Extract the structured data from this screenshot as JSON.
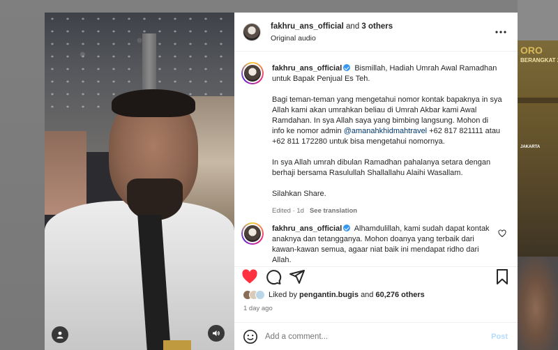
{
  "header": {
    "username": "fakhru_ans_official",
    "and_text": "and",
    "others_text": "3 others",
    "audio": "Original audio"
  },
  "caption": {
    "username": "fakhru_ans_official",
    "line1": "Bismillah, Hadiah Umrah Awal Ramadhan untuk Bapak Penjual Es Teh.",
    "para2_a": "Bagi teman-teman yang mengetahui nomor kontak bapaknya in sya Allah kami akan umrahkan beliau di Umrah Akbar kami Awal Ramdahan. In sya Allah saya yang bimbing langsung. Mohon di info ke nomor admin",
    "mention": "@amanahkhidmahtravel",
    "para2_b": "+62 817 821111 atau +62 811 172280 untuk bisa mengetahui nomornya.",
    "para3": "In sya Allah umrah dibulan Ramadhan pahalanya setara dengan berhaji bersama Rasulullah Shallallahu Alaihi Wasallam.",
    "para4": "Silahkan Share.",
    "edited": "Edited · 1d",
    "see_translation": "See translation"
  },
  "reply": {
    "username": "fakhru_ans_official",
    "text": "Alhamdulillah, kami sudah dapat kontak anaknya dan tetangganya. Mohon doanya yang terbaik dari kawan-kawan semua, agaar niat baik ini mendapat ridho dari Allah."
  },
  "likes": {
    "prefix": "Liked by",
    "user": "pengantin.bugis",
    "and": "and",
    "count": "60,276 others"
  },
  "time": "1 day ago",
  "comment_box": {
    "placeholder": "Add a comment...",
    "post": "Post"
  },
  "backdrop": {
    "poster_top": "ORO",
    "poster_sub": "BERANGKAT 2",
    "poster_city": "JAKARTA"
  },
  "colors": {
    "like_red": "#ff3040",
    "verified_blue": "#3897f0",
    "mention_blue": "#00376b",
    "post_disabled": "#b3dbff"
  }
}
